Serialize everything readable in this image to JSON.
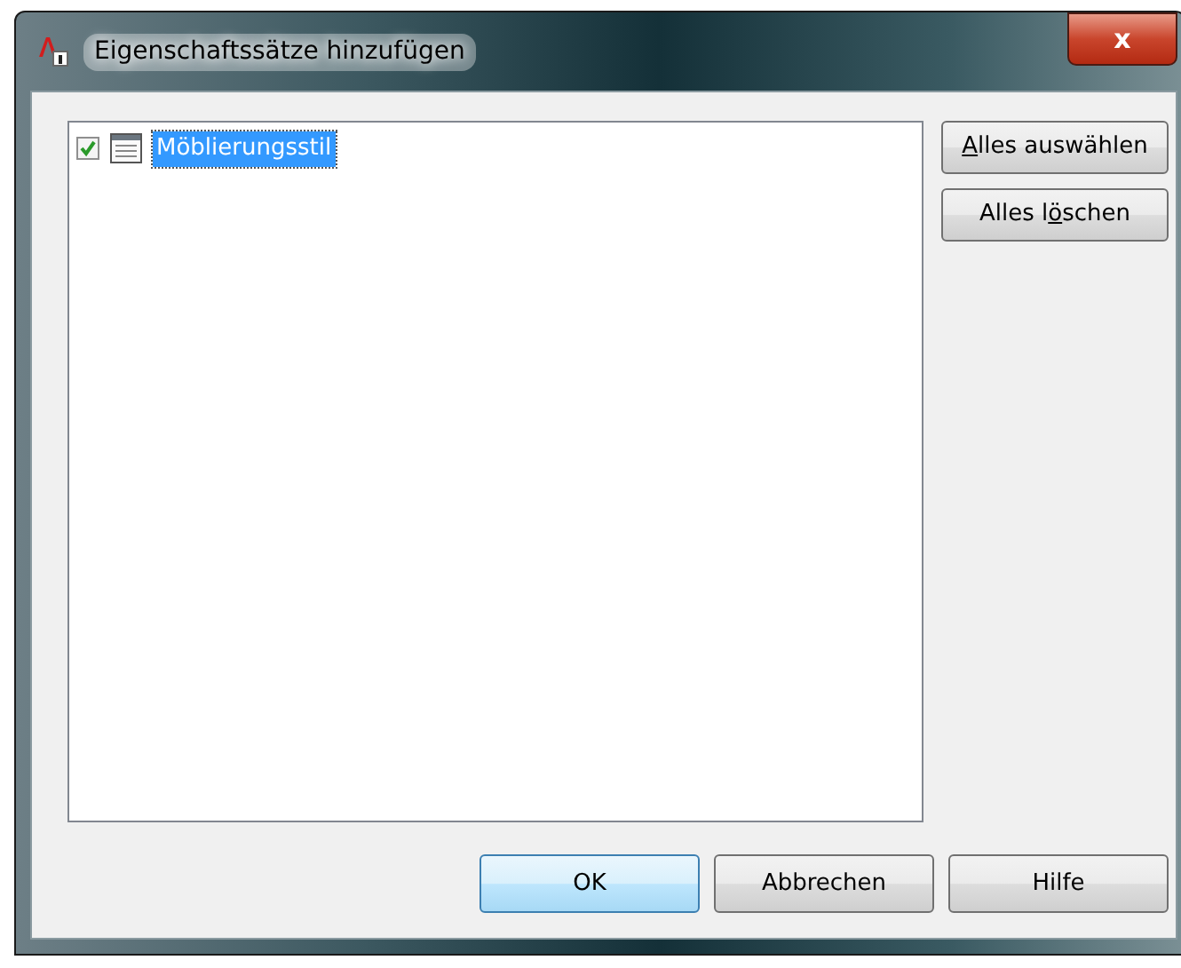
{
  "window": {
    "title": "Eigenschaftssätze hinzufügen",
    "close_label": "x"
  },
  "list": {
    "items": [
      {
        "label": "Möblierungsstil",
        "checked": true,
        "selected": true
      }
    ]
  },
  "side_buttons": [
    {
      "label_parts": [
        {
          "text": "A",
          "underlined": true
        },
        {
          "text": "lles auswählen",
          "underlined": false
        }
      ]
    },
    {
      "label_parts": [
        {
          "text": "Alles l",
          "underlined": false
        },
        {
          "text": "ö",
          "underlined": true
        },
        {
          "text": "schen",
          "underlined": false
        }
      ]
    }
  ],
  "buttons": [
    {
      "label": "OK",
      "default": true
    },
    {
      "label": "Abbrechen",
      "default": false
    },
    {
      "label": "Hilfe",
      "default": false
    }
  ]
}
